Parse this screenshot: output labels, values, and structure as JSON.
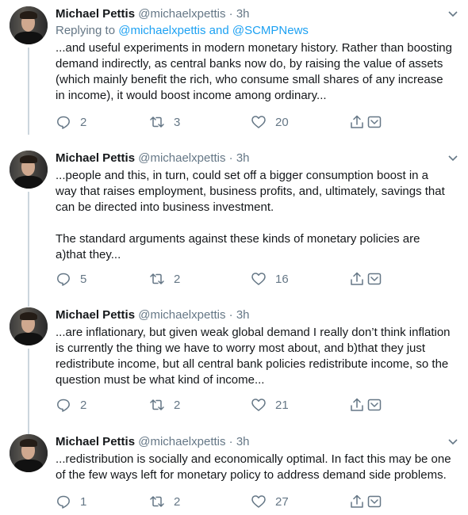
{
  "tweets": [
    {
      "name": "Michael Pettis",
      "handle": "@michaelxpettis",
      "sep": "·",
      "time": "3h",
      "reply_prefix": "Replying to ",
      "reply_targets": "@michaelxpettis and @SCMPNews",
      "paragraphs": [
        "...and useful experiments in modern monetary history. Rather than boosting demand indirectly, as central banks now do, by raising the value of assets (which mainly benefit the rich, who consume small shares of any increase in income), it would boost income among ordinary..."
      ],
      "replies": "2",
      "retweets": "3",
      "likes": "20"
    },
    {
      "name": "Michael Pettis",
      "handle": "@michaelxpettis",
      "sep": "·",
      "time": "3h",
      "paragraphs": [
        "...people and this, in turn, could set off a bigger consumption boost in a way that raises employment, business profits, and, ultimately, savings that can be directed into business investment.",
        "The standard arguments against these kinds of monetary policies are a)that they..."
      ],
      "replies": "5",
      "retweets": "2",
      "likes": "16"
    },
    {
      "name": "Michael Pettis",
      "handle": "@michaelxpettis",
      "sep": "·",
      "time": "3h",
      "paragraphs": [
        "...are inflationary, but given weak global demand I really don’t think inflation is currently the thing we have to worry most about, and b)that they just redistribute income, but all central bank policies redistribute income, so the question must be what kind of income..."
      ],
      "replies": "2",
      "retweets": "2",
      "likes": "21"
    },
    {
      "name": "Michael Pettis",
      "handle": "@michaelxpettis",
      "sep": "·",
      "time": "3h",
      "paragraphs": [
        "...redistribution is socially and economically optimal. In fact this may be one of the few ways left for monetary policy to address demand side problems."
      ],
      "replies": "1",
      "retweets": "2",
      "likes": "27"
    }
  ],
  "icons": {
    "reply": "reply-icon",
    "retweet": "retweet-icon",
    "like": "heart-icon",
    "share": "share-icon",
    "caret": "chevron-down-icon"
  },
  "colors": {
    "text": "#14171a",
    "muted": "#657786",
    "link": "#1da1f2",
    "thread_line": "#ccd6dd"
  }
}
